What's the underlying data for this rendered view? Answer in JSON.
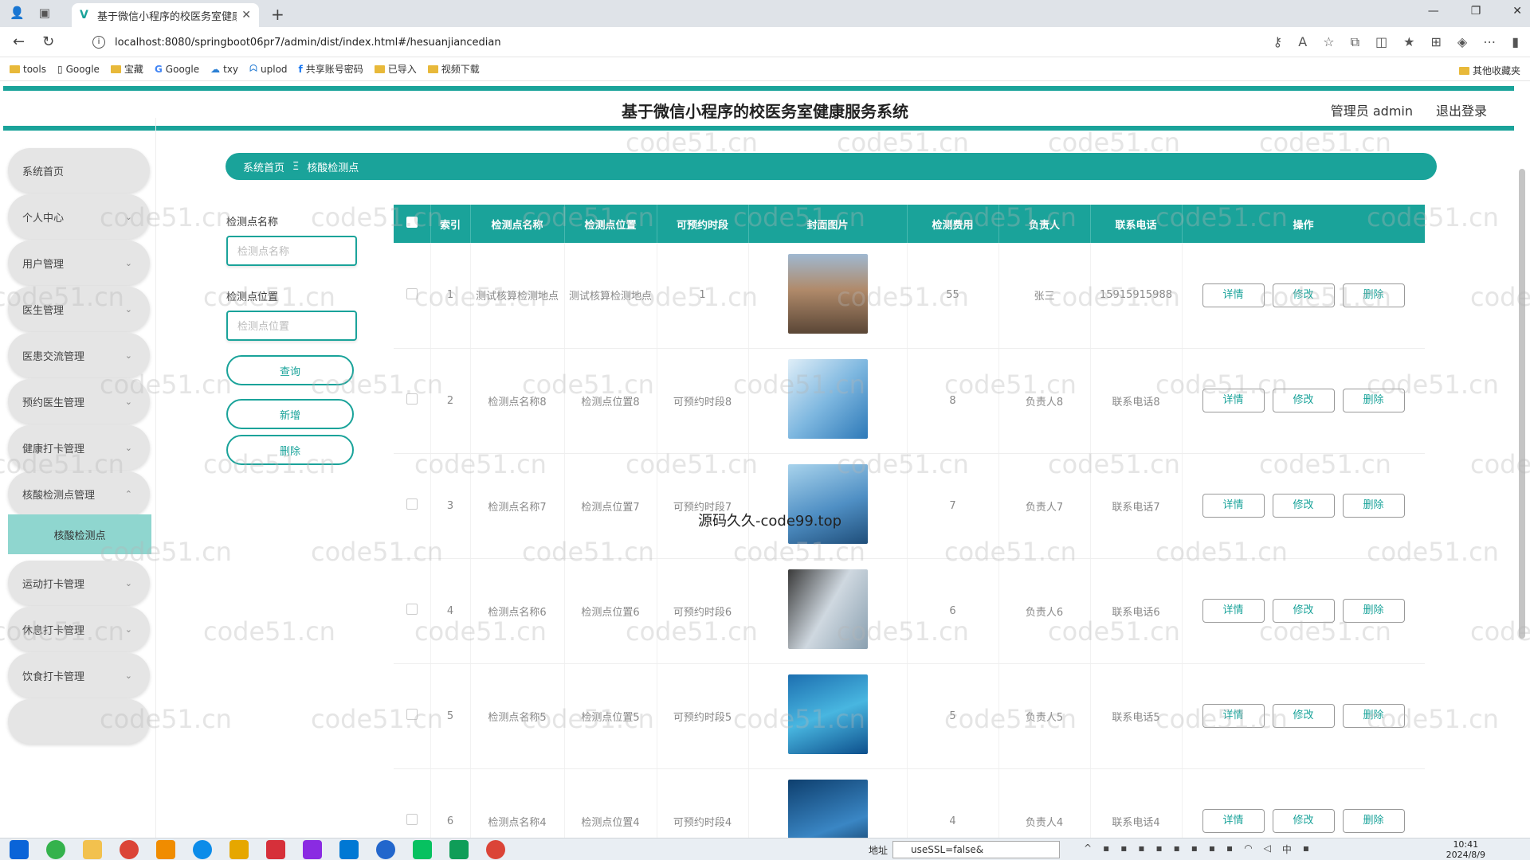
{
  "browser": {
    "tab_title": "基于微信小程序的校医务室健康服",
    "url": "localhost:8080/springboot06pr7/admin/dist/index.html#/hesuanjiancedian",
    "bookmarks": [
      "tools",
      "Google",
      "宝藏",
      "Google",
      "txy",
      "uplod",
      "共享账号密码",
      "已导入",
      "视频下载"
    ],
    "bookmarks_right": "其他收藏夹"
  },
  "header": {
    "title": "基于微信小程序的校医务室健康服务系统",
    "user": "管理员 admin",
    "logout": "退出登录"
  },
  "sidebar": {
    "items": [
      {
        "label": "系统首页",
        "chevron": false
      },
      {
        "label": "个人中心",
        "chevron": true
      },
      {
        "label": "用户管理",
        "chevron": true
      },
      {
        "label": "医生管理",
        "chevron": true
      },
      {
        "label": "医患交流管理",
        "chevron": true
      },
      {
        "label": "预约医生管理",
        "chevron": true
      },
      {
        "label": "健康打卡管理",
        "chevron": true
      },
      {
        "label": "核酸检测点管理",
        "chevron": true
      },
      {
        "label": "运动打卡管理",
        "chevron": true
      },
      {
        "label": "休息打卡管理",
        "chevron": true
      },
      {
        "label": "饮食打卡管理",
        "chevron": true
      }
    ],
    "active_sub": "核酸检测点"
  },
  "breadcrumb": {
    "home": "系统首页",
    "sep": "Ξ",
    "current": "核酸检测点"
  },
  "search": {
    "name_label": "检测点名称",
    "name_placeholder": "检测点名称",
    "location_label": "检测点位置",
    "location_placeholder": "检测点位置",
    "query_btn": "查询",
    "add_btn": "新增",
    "delete_btn": "删除"
  },
  "table": {
    "headers": [
      "索引",
      "检测点名称",
      "检测点位置",
      "可预约时段",
      "封面图片",
      "检测费用",
      "负责人",
      "联系电话",
      "操作"
    ],
    "actions": [
      "详情",
      "修改",
      "删除"
    ],
    "rows": [
      {
        "index": "1",
        "name": "测试核算检测地点",
        "location": "测试核算检测地点",
        "slot": "1",
        "fee": "55",
        "owner": "张三",
        "phone": "15915915988",
        "image": "hillside-town-image"
      },
      {
        "index": "2",
        "name": "检测点名称8",
        "location": "检测点位置8",
        "slot": "可预约时段8",
        "fee": "8",
        "owner": "负责人8",
        "phone": "联系电话8",
        "image": "medical-blue-image"
      },
      {
        "index": "3",
        "name": "检测点名称7",
        "location": "检测点位置7",
        "slot": "可预约时段7",
        "fee": "7",
        "owner": "负责人7",
        "phone": "联系电话7",
        "image": "operating-room-image"
      },
      {
        "index": "4",
        "name": "检测点名称6",
        "location": "检测点位置6",
        "slot": "可预约时段6",
        "fee": "6",
        "owner": "负责人6",
        "phone": "联系电话6",
        "image": "swab-test-image"
      },
      {
        "index": "5",
        "name": "检测点名称5",
        "location": "检测点位置5",
        "slot": "可预约时段5",
        "fee": "5",
        "owner": "负责人5",
        "phone": "联系电话5",
        "image": "medics-heart-image"
      },
      {
        "index": "6",
        "name": "检测点名称4",
        "location": "检测点位置4",
        "slot": "可预约时段4",
        "fee": "4",
        "owner": "负责人4",
        "phone": "联系电话4",
        "image": "doctor-blue-image"
      }
    ]
  },
  "overlay_text": "源码久久-code99.top",
  "watermark": "code51.cn",
  "taskbar": {
    "addr_label": "地址",
    "addr_value": "useSSL=false&",
    "time": "10:41",
    "date": "2024/8/9",
    "ime": "中"
  },
  "colors": {
    "accent": "#1aa39a",
    "sub_active": "#8fd6cf"
  }
}
